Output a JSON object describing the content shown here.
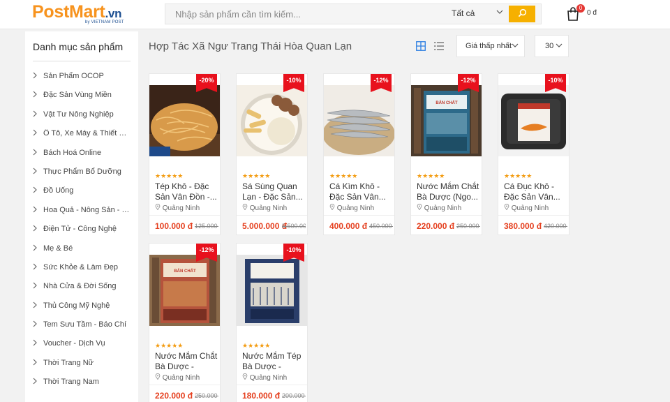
{
  "header": {
    "logo_post": "Post",
    "logo_mart": "Mart",
    "logo_vn": ".vn",
    "logo_sub": "by VIETNAM POST",
    "search_placeholder": "Nhập sản phẩm cần tìm kiếm...",
    "search_category": "Tất cả",
    "cart_count": "0",
    "cart_total": "0 đ"
  },
  "sidebar": {
    "title": "Danh mục sản phẩm",
    "items": [
      {
        "label": "Sản Phẩm OCOP"
      },
      {
        "label": "Đặc Sản Vùng Miền"
      },
      {
        "label": "Vật Tư Nông Nghiệp"
      },
      {
        "label": "Ô Tô, Xe Máy & Thiết Bị ..."
      },
      {
        "label": "Bách Hoá Online"
      },
      {
        "label": "Thực Phẩm Bổ Dưỡng"
      },
      {
        "label": "Đồ Uống"
      },
      {
        "label": "Hoa Quả - Nông Sản - T..."
      },
      {
        "label": "Điện Tử - Công Nghệ"
      },
      {
        "label": "Mẹ & Bé"
      },
      {
        "label": "Sức Khỏe & Làm Đẹp"
      },
      {
        "label": "Nhà Cửa & Đời Sống"
      },
      {
        "label": "Thủ Công Mỹ Nghệ"
      },
      {
        "label": "Tem Sưu Tầm - Báo Chí"
      },
      {
        "label": "Voucher - Dịch Vụ"
      },
      {
        "label": "Thời Trang Nữ"
      },
      {
        "label": "Thời Trang Nam"
      }
    ]
  },
  "main": {
    "title": "Hợp Tác Xã Ngư Trang Thái Hòa Quan Lạn",
    "sort_label": "Giá thấp nhất",
    "per_page": "30"
  },
  "products": [
    {
      "discount": "-20%",
      "stars": "★★★★★",
      "name": "Tép Khô - Đặc Sản Vân Đồn -...",
      "location": "Quảng Ninh",
      "price": "100.000 đ",
      "old_price": "125.000 đ",
      "image": "dried-shrimp"
    },
    {
      "discount": "-10%",
      "stars": "★★★★★",
      "name": "Sá Sùng Quan Lạn - Đặc Sản...",
      "location": "Quảng Ninh",
      "price": "5.000.000 đ",
      "old_price": "5.500.000 đ",
      "image": "peanut-worm"
    },
    {
      "discount": "-12%",
      "stars": "★★★★★",
      "name": "Cá Kìm Khô - Đặc Sản Vân...",
      "location": "Quảng Ninh",
      "price": "400.000 đ",
      "old_price": "450.000 đ",
      "image": "dried-halfbeak-fish"
    },
    {
      "discount": "-12%",
      "stars": "★★★★★",
      "name": "Nước Mắm Chắt Bà Dược (Ngo...",
      "location": "Quảng Ninh",
      "price": "220.000 đ",
      "old_price": "250.000 đ",
      "image": "fish-sauce-box-blue"
    },
    {
      "discount": "-10%",
      "stars": "★★★★★",
      "name": "Cá Đục Khô - Đặc Sản Vân...",
      "location": "Quảng Ninh",
      "price": "380.000 đ",
      "old_price": "420.000 đ",
      "image": "dried-fish-tray"
    },
    {
      "discount": "-12%",
      "stars": "★★★★★",
      "name": "Nước Mắm Chắt Bà Dược - Hộp...",
      "location": "Quảng Ninh",
      "price": "220.000 đ",
      "old_price": "250.000 đ",
      "image": "fish-sauce-box-red"
    },
    {
      "discount": "-10%",
      "stars": "★★★★★",
      "name": "Nước Mắm Tép Bà Dược - Hộp...",
      "location": "Quảng Ninh",
      "price": "180.000 đ",
      "old_price": "200.000 đ",
      "image": "fish-sauce-box-navy"
    }
  ],
  "colors": {
    "brand_orange": "#f7931e",
    "brand_blue": "#1d4f91",
    "search_button": "#f6b000",
    "badge_red": "#e8111d",
    "price_red": "#e53f1e",
    "star": "#f39c12"
  },
  "icons": [
    "search-icon",
    "cart-icon",
    "chevron-right-icon",
    "chevron-down-icon",
    "grid-view-icon",
    "list-view-icon",
    "location-pin-icon",
    "star-icon"
  ]
}
